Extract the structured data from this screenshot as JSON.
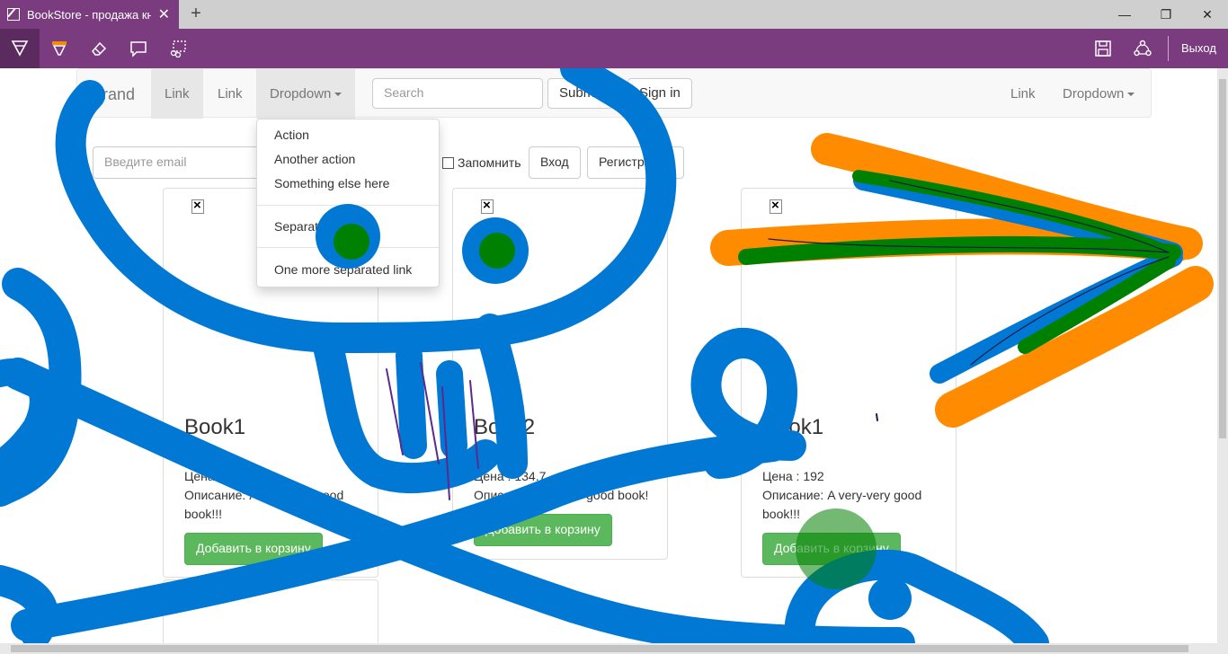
{
  "browser": {
    "tab_title": "BookStore - продажа книг",
    "new_tab": "+",
    "close_tab": "✕",
    "minimize": "—",
    "restore": "❐",
    "close_window": "✕"
  },
  "inking_toolbar": {
    "tools": [
      "ballpoint-pen-icon",
      "highlighter-icon",
      "eraser-icon",
      "comment-icon",
      "clip-icon"
    ],
    "right_tools": [
      "save-icon",
      "share-icon"
    ],
    "exit_label": "Выход",
    "colors": {
      "bar": "#7b3b7f",
      "active": "#5b2a5f",
      "highlighter": "#f28c00"
    }
  },
  "navbar": {
    "brand": "Brand",
    "links": [
      "Link",
      "Link"
    ],
    "dropdown_label": "Dropdown",
    "search_placeholder": "Search",
    "submit_label": "Submit",
    "signin_label": "Sign in",
    "right_link": "Link",
    "right_dropdown": "Dropdown"
  },
  "dropdown_menu": {
    "items": [
      "Action",
      "Another action",
      "Something else here"
    ],
    "separated": "Separated link",
    "one_more": "One more separated link"
  },
  "login_form": {
    "email_placeholder": "Введите email",
    "remember_label": "Запомнить",
    "login_button": "Вход",
    "register_button": "Регистрация"
  },
  "books": [
    {
      "title": "Book1",
      "price": "Цена : 192",
      "description": "Описание: A very-very good book!!!",
      "button": "Добавить в корзину"
    },
    {
      "title": "Book2",
      "price": "Цена : 134.7",
      "description": "Описание: Another good book!",
      "button": "Добавить в корзину"
    },
    {
      "title": "Book1",
      "price": "Цена : 192",
      "description": "Описание: A very-very good book!!!",
      "button": "Добавить в корзину"
    }
  ],
  "ink_colors": {
    "blue": "#0078d4",
    "green": "#008000",
    "orange": "#ff8c00",
    "purple": "#5b2a8c",
    "dark": "#1a1a4a"
  }
}
